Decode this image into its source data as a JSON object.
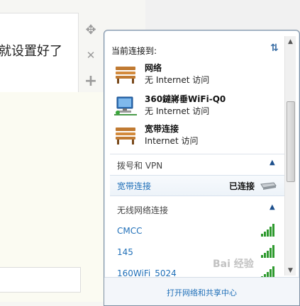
{
  "background": {
    "text_fragment": "就设置好了"
  },
  "side_tools": [
    {
      "icon": "move-icon",
      "glyph": "✥"
    },
    {
      "icon": "close-icon",
      "glyph": "✕"
    },
    {
      "icon": "add-icon",
      "glyph": "+"
    }
  ],
  "popup": {
    "current_label": "当前连接到:",
    "refresh_glyph": "⇅",
    "connections": [
      {
        "name": "网络",
        "status": "无 Internet 访问",
        "icon": "bench-network-icon"
      },
      {
        "name": "360鐽嶈垂WiFi-Q0",
        "status": "无 Internet 访问",
        "icon": "computer-network-icon"
      },
      {
        "name": "宽带连接",
        "status": "Internet 访问",
        "icon": "bench-network-icon"
      }
    ],
    "vpn_section": {
      "label": "拨号和 VPN",
      "toggle": "▲",
      "items": [
        {
          "name": "宽带连接",
          "status": "已连接"
        }
      ]
    },
    "wireless_section": {
      "label": "无线网络连接",
      "toggle": "▲",
      "networks": [
        {
          "name": "CMCC",
          "signal": 5
        },
        {
          "name": "145",
          "signal": 5
        },
        {
          "name": "160WiFi_5024",
          "signal": 5
        }
      ]
    },
    "footer_link": "打开网络和共享中心"
  },
  "watermark": "Bai 经验",
  "colors": {
    "link_blue": "#1f6fb8",
    "signal_green": "#2e9a2e",
    "popup_border": "#7d8fa3"
  }
}
